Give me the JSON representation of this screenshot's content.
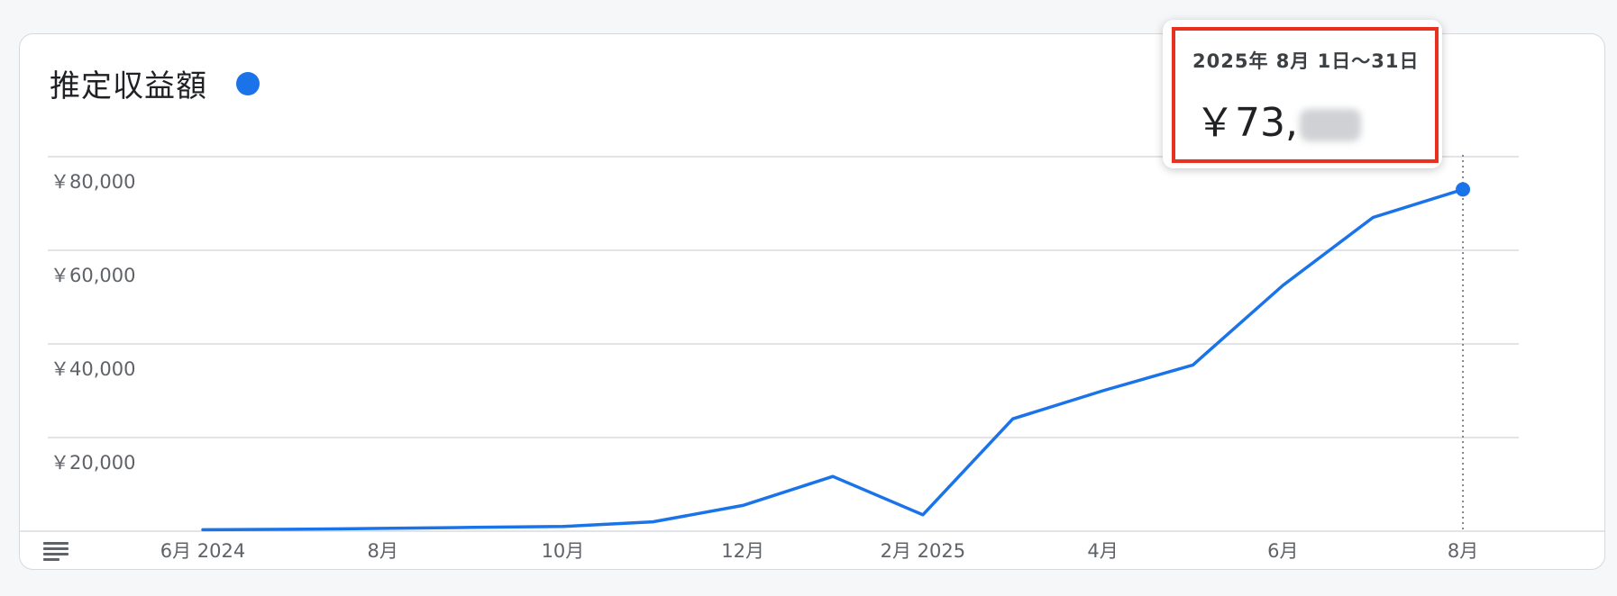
{
  "card": {
    "title": "推定収益額",
    "series_color": "#1a73e8"
  },
  "tooltip": {
    "date": "2025年 8月 1日〜31日",
    "value_prefix": "￥73,"
  },
  "icons": {
    "menu": "table-view-icon"
  },
  "chart_data": {
    "type": "line",
    "x": [
      "2024-06",
      "2024-07",
      "2024-08",
      "2024-09",
      "2024-10",
      "2024-11",
      "2024-12",
      "2025-01",
      "2025-02",
      "2025-03",
      "2025-04",
      "2025-05",
      "2025-06",
      "2025-07",
      "2025-08"
    ],
    "x_ticks": [
      {
        "at": "2024-06",
        "label": "6月 2024"
      },
      {
        "at": "2024-08",
        "label": "8月"
      },
      {
        "at": "2024-10",
        "label": "10月"
      },
      {
        "at": "2024-12",
        "label": "12月"
      },
      {
        "at": "2025-02",
        "label": "2月 2025"
      },
      {
        "at": "2025-04",
        "label": "4月"
      },
      {
        "at": "2025-06",
        "label": "6月"
      },
      {
        "at": "2025-08",
        "label": "8月"
      }
    ],
    "series": [
      {
        "values": [
          300,
          400,
          600,
          800,
          1000,
          2000,
          5500,
          11700,
          3500,
          24000,
          30000,
          35500,
          52500,
          67000,
          73000
        ],
        "color": "#1a73e8"
      }
    ],
    "ylim": [
      0,
      80000
    ],
    "y_ticks": [
      {
        "value": 20000,
        "label": "￥20,000"
      },
      {
        "value": 40000,
        "label": "￥40,000"
      },
      {
        "value": 60000,
        "label": "￥60,000"
      },
      {
        "value": 80000,
        "label": "￥80,000"
      }
    ],
    "highlight_index": 14,
    "grid": true,
    "legend": "none"
  }
}
